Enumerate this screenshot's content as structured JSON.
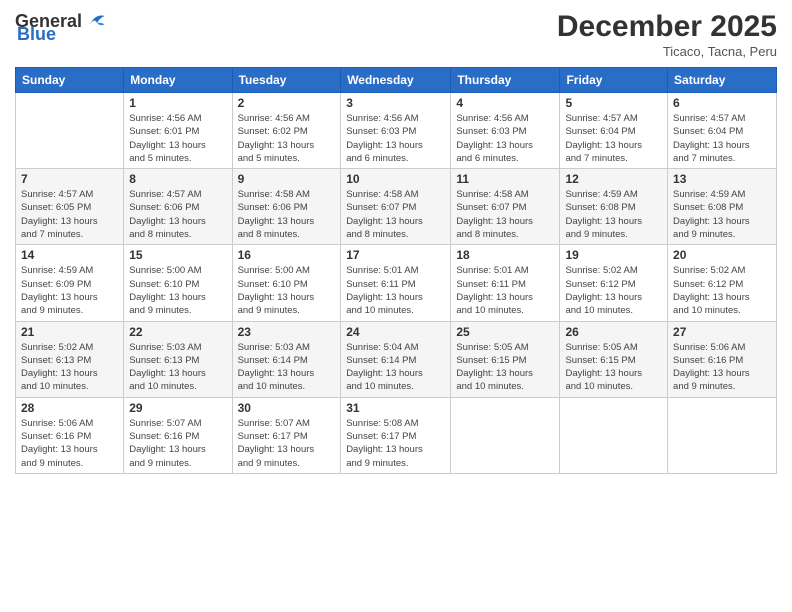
{
  "header": {
    "logo_general": "General",
    "logo_blue": "Blue",
    "month_title": "December 2025",
    "location": "Ticaco, Tacna, Peru"
  },
  "calendar": {
    "weekdays": [
      "Sunday",
      "Monday",
      "Tuesday",
      "Wednesday",
      "Thursday",
      "Friday",
      "Saturday"
    ],
    "weeks": [
      [
        {
          "day": "",
          "info": ""
        },
        {
          "day": "1",
          "info": "Sunrise: 4:56 AM\nSunset: 6:01 PM\nDaylight: 13 hours\nand 5 minutes."
        },
        {
          "day": "2",
          "info": "Sunrise: 4:56 AM\nSunset: 6:02 PM\nDaylight: 13 hours\nand 5 minutes."
        },
        {
          "day": "3",
          "info": "Sunrise: 4:56 AM\nSunset: 6:03 PM\nDaylight: 13 hours\nand 6 minutes."
        },
        {
          "day": "4",
          "info": "Sunrise: 4:56 AM\nSunset: 6:03 PM\nDaylight: 13 hours\nand 6 minutes."
        },
        {
          "day": "5",
          "info": "Sunrise: 4:57 AM\nSunset: 6:04 PM\nDaylight: 13 hours\nand 7 minutes."
        },
        {
          "day": "6",
          "info": "Sunrise: 4:57 AM\nSunset: 6:04 PM\nDaylight: 13 hours\nand 7 minutes."
        }
      ],
      [
        {
          "day": "7",
          "info": "Sunrise: 4:57 AM\nSunset: 6:05 PM\nDaylight: 13 hours\nand 7 minutes."
        },
        {
          "day": "8",
          "info": "Sunrise: 4:57 AM\nSunset: 6:06 PM\nDaylight: 13 hours\nand 8 minutes."
        },
        {
          "day": "9",
          "info": "Sunrise: 4:58 AM\nSunset: 6:06 PM\nDaylight: 13 hours\nand 8 minutes."
        },
        {
          "day": "10",
          "info": "Sunrise: 4:58 AM\nSunset: 6:07 PM\nDaylight: 13 hours\nand 8 minutes."
        },
        {
          "day": "11",
          "info": "Sunrise: 4:58 AM\nSunset: 6:07 PM\nDaylight: 13 hours\nand 8 minutes."
        },
        {
          "day": "12",
          "info": "Sunrise: 4:59 AM\nSunset: 6:08 PM\nDaylight: 13 hours\nand 9 minutes."
        },
        {
          "day": "13",
          "info": "Sunrise: 4:59 AM\nSunset: 6:08 PM\nDaylight: 13 hours\nand 9 minutes."
        }
      ],
      [
        {
          "day": "14",
          "info": "Sunrise: 4:59 AM\nSunset: 6:09 PM\nDaylight: 13 hours\nand 9 minutes."
        },
        {
          "day": "15",
          "info": "Sunrise: 5:00 AM\nSunset: 6:10 PM\nDaylight: 13 hours\nand 9 minutes."
        },
        {
          "day": "16",
          "info": "Sunrise: 5:00 AM\nSunset: 6:10 PM\nDaylight: 13 hours\nand 9 minutes."
        },
        {
          "day": "17",
          "info": "Sunrise: 5:01 AM\nSunset: 6:11 PM\nDaylight: 13 hours\nand 10 minutes."
        },
        {
          "day": "18",
          "info": "Sunrise: 5:01 AM\nSunset: 6:11 PM\nDaylight: 13 hours\nand 10 minutes."
        },
        {
          "day": "19",
          "info": "Sunrise: 5:02 AM\nSunset: 6:12 PM\nDaylight: 13 hours\nand 10 minutes."
        },
        {
          "day": "20",
          "info": "Sunrise: 5:02 AM\nSunset: 6:12 PM\nDaylight: 13 hours\nand 10 minutes."
        }
      ],
      [
        {
          "day": "21",
          "info": "Sunrise: 5:02 AM\nSunset: 6:13 PM\nDaylight: 13 hours\nand 10 minutes."
        },
        {
          "day": "22",
          "info": "Sunrise: 5:03 AM\nSunset: 6:13 PM\nDaylight: 13 hours\nand 10 minutes."
        },
        {
          "day": "23",
          "info": "Sunrise: 5:03 AM\nSunset: 6:14 PM\nDaylight: 13 hours\nand 10 minutes."
        },
        {
          "day": "24",
          "info": "Sunrise: 5:04 AM\nSunset: 6:14 PM\nDaylight: 13 hours\nand 10 minutes."
        },
        {
          "day": "25",
          "info": "Sunrise: 5:05 AM\nSunset: 6:15 PM\nDaylight: 13 hours\nand 10 minutes."
        },
        {
          "day": "26",
          "info": "Sunrise: 5:05 AM\nSunset: 6:15 PM\nDaylight: 13 hours\nand 10 minutes."
        },
        {
          "day": "27",
          "info": "Sunrise: 5:06 AM\nSunset: 6:16 PM\nDaylight: 13 hours\nand 9 minutes."
        }
      ],
      [
        {
          "day": "28",
          "info": "Sunrise: 5:06 AM\nSunset: 6:16 PM\nDaylight: 13 hours\nand 9 minutes."
        },
        {
          "day": "29",
          "info": "Sunrise: 5:07 AM\nSunset: 6:16 PM\nDaylight: 13 hours\nand 9 minutes."
        },
        {
          "day": "30",
          "info": "Sunrise: 5:07 AM\nSunset: 6:17 PM\nDaylight: 13 hours\nand 9 minutes."
        },
        {
          "day": "31",
          "info": "Sunrise: 5:08 AM\nSunset: 6:17 PM\nDaylight: 13 hours\nand 9 minutes."
        },
        {
          "day": "",
          "info": ""
        },
        {
          "day": "",
          "info": ""
        },
        {
          "day": "",
          "info": ""
        }
      ]
    ]
  }
}
